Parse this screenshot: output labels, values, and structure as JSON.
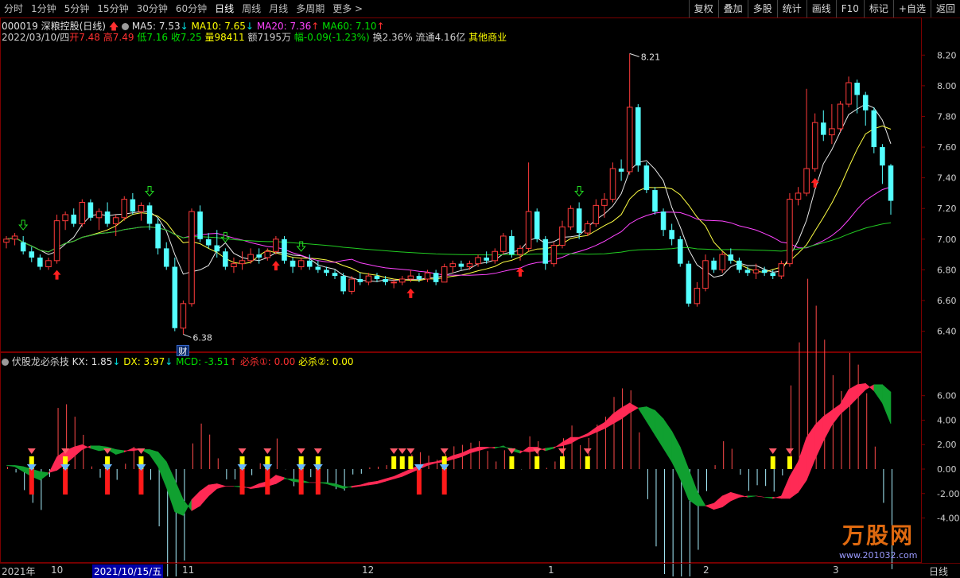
{
  "toolbar": {
    "tabs": [
      "分时",
      "1分钟",
      "5分钟",
      "15分钟",
      "30分钟",
      "60分钟",
      "日线",
      "周线",
      "月线",
      "多周期",
      "更多 >"
    ],
    "active_tab": "日线",
    "right_buttons": [
      "复权",
      "叠加",
      "多股",
      "统计",
      "画线",
      "F10",
      "标记",
      "+自选",
      "返回"
    ]
  },
  "stock": {
    "title": "000019 深粮控股(日线)",
    "ma5": "MA5: 7.53",
    "ma10": "MA10: 7.65",
    "ma20": "MA20: 7.36",
    "ma60": "MA60: 7.10",
    "date": "2022/03/10/四",
    "open": "开7.48",
    "high": "高7.49",
    "low": "低7.16",
    "close": "收7.25",
    "volume": "量98411",
    "amount": "额7195万",
    "change": "幅-0.09(-1.23%)",
    "turnover": "换2.36%",
    "float": "流通4.16亿",
    "sector": "其他商业"
  },
  "price_axis": [
    "8.20",
    "8.00",
    "7.80",
    "7.60",
    "7.40",
    "7.20",
    "7.00",
    "6.80",
    "6.60",
    "6.40"
  ],
  "annotations": {
    "high_label": "8.21",
    "low_label": "6.38",
    "fin_badge": "财"
  },
  "indicator": {
    "name": "伏股龙必杀技",
    "kx": "KX: 1.85",
    "dx": "DX: 3.97",
    "mcd": "MCD: -3.51",
    "bisha1": "必杀①: 0.00",
    "bisha2": "必杀②: 0.00",
    "axis": [
      "6.00",
      "4.00",
      "2.00",
      "0.00",
      "-2.00",
      "-4.00"
    ]
  },
  "dates": {
    "labels": [
      "2021年",
      "10",
      "2021/10/15/五",
      "11",
      "12",
      "1",
      "2",
      "3"
    ],
    "period": "日线"
  },
  "watermark": {
    "brand": "万股网",
    "url": "www.201032.com"
  },
  "chart_data": {
    "type": "candlestick",
    "title": "000019 深粮控股(日线)",
    "y_range": [
      6.32,
      8.3
    ],
    "marked_high": 8.21,
    "marked_low": 6.38,
    "candles": [
      [
        6.98,
        7.02,
        6.94,
        7.0
      ],
      [
        7.0,
        7.04,
        6.96,
        7.02
      ],
      [
        6.98,
        7.02,
        6.9,
        6.92
      ],
      [
        6.92,
        6.95,
        6.85,
        6.88
      ],
      [
        6.88,
        6.9,
        6.8,
        6.82
      ],
      [
        6.82,
        6.88,
        6.8,
        6.86
      ],
      [
        6.86,
        7.16,
        6.84,
        7.12
      ],
      [
        7.12,
        7.18,
        7.06,
        7.16
      ],
      [
        7.16,
        7.2,
        7.08,
        7.1
      ],
      [
        7.1,
        7.26,
        7.08,
        7.24
      ],
      [
        7.24,
        7.26,
        7.12,
        7.14
      ],
      [
        7.14,
        7.2,
        7.06,
        7.18
      ],
      [
        7.18,
        7.24,
        7.08,
        7.1
      ],
      [
        7.1,
        7.16,
        7.02,
        7.14
      ],
      [
        7.14,
        7.28,
        7.12,
        7.26
      ],
      [
        7.26,
        7.3,
        7.16,
        7.18
      ],
      [
        7.18,
        7.24,
        7.12,
        7.22
      ],
      [
        7.22,
        7.24,
        7.06,
        7.1
      ],
      [
        7.1,
        7.14,
        6.9,
        6.94
      ],
      [
        6.94,
        6.98,
        6.8,
        6.82
      ],
      [
        6.82,
        6.88,
        6.4,
        6.42
      ],
      [
        6.42,
        6.6,
        6.38,
        6.58
      ],
      [
        6.58,
        7.2,
        6.56,
        7.18
      ],
      [
        7.18,
        7.22,
        6.98,
        7.0
      ],
      [
        7.0,
        7.04,
        6.94,
        6.96
      ],
      [
        6.96,
        7.06,
        6.88,
        6.92
      ],
      [
        6.92,
        6.94,
        6.8,
        6.82
      ],
      [
        6.82,
        6.88,
        6.78,
        6.84
      ],
      [
        6.84,
        6.92,
        6.8,
        6.86
      ],
      [
        6.86,
        6.94,
        6.84,
        6.9
      ],
      [
        6.9,
        6.94,
        6.84,
        6.88
      ],
      [
        6.88,
        6.94,
        6.86,
        6.92
      ],
      [
        6.92,
        7.02,
        6.9,
        7.0
      ],
      [
        7.0,
        7.02,
        6.84,
        6.86
      ],
      [
        6.86,
        6.88,
        6.78,
        6.82
      ],
      [
        6.82,
        6.88,
        6.8,
        6.86
      ],
      [
        6.86,
        6.9,
        6.8,
        6.82
      ],
      [
        6.82,
        6.86,
        6.78,
        6.8
      ],
      [
        6.8,
        6.82,
        6.76,
        6.78
      ],
      [
        6.78,
        6.8,
        6.74,
        6.76
      ],
      [
        6.76,
        6.78,
        6.64,
        6.66
      ],
      [
        6.66,
        6.76,
        6.64,
        6.74
      ],
      [
        6.74,
        6.78,
        6.7,
        6.72
      ],
      [
        6.72,
        6.78,
        6.7,
        6.76
      ],
      [
        6.76,
        6.78,
        6.72,
        6.74
      ],
      [
        6.74,
        6.76,
        6.7,
        6.72
      ],
      [
        6.72,
        6.74,
        6.68,
        6.72
      ],
      [
        6.72,
        6.76,
        6.7,
        6.74
      ],
      [
        6.74,
        6.8,
        6.72,
        6.76
      ],
      [
        6.76,
        6.78,
        6.72,
        6.74
      ],
      [
        6.74,
        6.8,
        6.72,
        6.78
      ],
      [
        6.78,
        6.8,
        6.7,
        6.72
      ],
      [
        6.72,
        6.84,
        6.72,
        6.82
      ],
      [
        6.82,
        6.86,
        6.78,
        6.84
      ],
      [
        6.84,
        6.86,
        6.8,
        6.82
      ],
      [
        6.82,
        6.86,
        6.8,
        6.84
      ],
      [
        6.84,
        6.9,
        6.82,
        6.88
      ],
      [
        6.88,
        6.92,
        6.84,
        6.86
      ],
      [
        6.86,
        6.94,
        6.84,
        6.92
      ],
      [
        6.92,
        7.04,
        6.9,
        7.02
      ],
      [
        7.02,
        7.06,
        6.88,
        6.9
      ],
      [
        6.9,
        6.96,
        6.86,
        6.94
      ],
      [
        6.94,
        7.5,
        6.92,
        7.18
      ],
      [
        7.18,
        7.2,
        6.98,
        7.0
      ],
      [
        7.0,
        7.02,
        6.8,
        6.84
      ],
      [
        6.84,
        6.98,
        6.82,
        6.96
      ],
      [
        6.96,
        7.12,
        6.94,
        7.08
      ],
      [
        7.08,
        7.22,
        7.06,
        7.2
      ],
      [
        7.2,
        7.24,
        7.0,
        7.04
      ],
      [
        7.04,
        7.12,
        7.02,
        7.1
      ],
      [
        7.1,
        7.26,
        7.08,
        7.22
      ],
      [
        7.22,
        7.3,
        7.14,
        7.26
      ],
      [
        7.26,
        7.5,
        7.24,
        7.46
      ],
      [
        7.46,
        7.52,
        7.38,
        7.44
      ],
      [
        7.44,
        8.21,
        7.42,
        7.86
      ],
      [
        7.86,
        7.88,
        7.44,
        7.48
      ],
      [
        7.48,
        7.5,
        7.3,
        7.32
      ],
      [
        7.32,
        7.34,
        7.16,
        7.18
      ],
      [
        7.18,
        7.2,
        7.02,
        7.06
      ],
      [
        7.06,
        7.1,
        6.96,
        7.0
      ],
      [
        7.0,
        7.02,
        6.82,
        6.84
      ],
      [
        6.84,
        6.86,
        6.56,
        6.58
      ],
      [
        6.58,
        6.72,
        6.56,
        6.68
      ],
      [
        6.68,
        6.9,
        6.66,
        6.86
      ],
      [
        6.86,
        6.88,
        6.78,
        6.8
      ],
      [
        6.8,
        6.92,
        6.78,
        6.9
      ],
      [
        6.9,
        6.94,
        6.84,
        6.86
      ],
      [
        6.86,
        6.88,
        6.78,
        6.8
      ],
      [
        6.8,
        6.82,
        6.76,
        6.78
      ],
      [
        6.78,
        6.84,
        6.74,
        6.8
      ],
      [
        6.8,
        6.82,
        6.76,
        6.78
      ],
      [
        6.78,
        6.8,
        6.74,
        6.76
      ],
      [
        6.76,
        6.86,
        6.74,
        6.84
      ],
      [
        6.84,
        7.3,
        6.82,
        7.26
      ],
      [
        7.26,
        7.34,
        7.22,
        7.3
      ],
      [
        7.3,
        7.98,
        7.28,
        7.46
      ],
      [
        7.46,
        7.82,
        7.44,
        7.76
      ],
      [
        7.76,
        7.84,
        7.64,
        7.68
      ],
      [
        7.68,
        7.88,
        7.62,
        7.72
      ],
      [
        7.72,
        7.9,
        7.7,
        7.88
      ],
      [
        7.88,
        8.06,
        7.86,
        8.02
      ],
      [
        8.02,
        8.04,
        7.82,
        7.94
      ],
      [
        7.94,
        7.96,
        7.74,
        7.84
      ],
      [
        7.84,
        7.86,
        7.56,
        7.6
      ],
      [
        7.6,
        7.62,
        7.36,
        7.48
      ],
      [
        7.48,
        7.49,
        7.16,
        7.25
      ]
    ],
    "ma_series": [
      {
        "name": "MA5",
        "color": "#e8e8e8"
      },
      {
        "name": "MA10",
        "color": "#ffff44"
      },
      {
        "name": "MA20",
        "color": "#ff44ff"
      },
      {
        "name": "MA60",
        "color": "#22cc22"
      }
    ],
    "indicator_series": {
      "name": "伏股龙必杀技",
      "y_range": [
        -6.5,
        7.8
      ],
      "kx": [
        0.3,
        0.2,
        -0.2,
        -0.6,
        -0.9,
        -0.4,
        1.0,
        1.5,
        1.8,
        2.0,
        1.7,
        1.5,
        1.6,
        1.2,
        1.4,
        1.7,
        1.6,
        1.2,
        0.2,
        -1.5,
        -3.5,
        -3.8,
        -2.5,
        -1.8,
        -1.3,
        -1.2,
        -1.4,
        -1.4,
        -1.5,
        -1.5,
        -1.2,
        -1.0,
        -0.5,
        -0.7,
        -1.0,
        -1.1,
        -1.1,
        -1.1,
        -1.2,
        -1.4,
        -1.6,
        -1.4,
        -1.3,
        -1.1,
        -1.0,
        -0.8,
        -0.6,
        -0.3,
        0.0,
        0.3,
        0.5,
        0.6,
        0.8,
        1.1,
        1.3,
        1.6,
        1.8,
        1.8,
        1.7,
        1.9,
        1.5,
        1.3,
        1.8,
        1.8,
        1.5,
        1.7,
        2.2,
        2.6,
        2.6,
        2.9,
        3.4,
        3.8,
        4.5,
        5.0,
        5.4,
        5.0,
        3.9,
        2.8,
        1.7,
        0.6,
        -0.8,
        -2.5,
        -3.0,
        -3.0,
        -2.8,
        -2.2,
        -1.9,
        -2.1,
        -2.3,
        -2.2,
        -2.3,
        -2.4,
        -2.2,
        -0.6,
        0.6,
        2.6,
        3.6,
        4.3,
        4.8,
        5.3,
        6.5,
        6.9,
        7.0,
        6.4,
        5.4,
        3.7
      ],
      "dx": [
        0.3,
        0.3,
        0.2,
        0.0,
        -0.2,
        -0.3,
        -0.1,
        0.4,
        1.0,
        1.6,
        1.9,
        1.9,
        1.8,
        1.6,
        1.5,
        1.5,
        1.6,
        1.6,
        1.4,
        0.6,
        -0.9,
        -2.5,
        -3.4,
        -3.0,
        -2.2,
        -1.6,
        -1.4,
        -1.4,
        -1.4,
        -1.6,
        -1.5,
        -1.4,
        -1.2,
        -0.8,
        -0.8,
        -0.9,
        -1.1,
        -1.1,
        -1.1,
        -1.2,
        -1.4,
        -1.5,
        -1.4,
        -1.3,
        -1.2,
        -1.0,
        -0.8,
        -0.6,
        -0.3,
        0.0,
        0.3,
        0.5,
        0.6,
        0.8,
        1.0,
        1.3,
        1.5,
        1.7,
        1.8,
        1.8,
        1.7,
        1.5,
        1.4,
        1.5,
        1.7,
        1.8,
        1.9,
        2.1,
        2.5,
        2.7,
        3.0,
        3.3,
        3.7,
        4.1,
        4.6,
        5.0,
        5.1,
        4.8,
        4.1,
        3.1,
        1.8,
        0.0,
        -1.8,
        -3.0,
        -3.3,
        -3.1,
        -2.6,
        -2.3,
        -2.2,
        -2.2,
        -2.3,
        -2.3,
        -2.4,
        -2.4,
        -1.9,
        -0.9,
        0.8,
        2.3,
        3.6,
        4.5,
        5.1,
        5.8,
        6.5,
        6.9,
        6.9,
        6.3
      ],
      "bisha1_days": [
        3,
        7,
        12,
        16,
        28,
        31,
        35,
        37,
        49,
        52
      ],
      "bisha2_days": [
        3,
        7,
        12,
        16,
        28,
        31,
        35,
        37,
        46,
        47,
        48,
        52,
        60,
        63,
        66,
        69,
        91,
        93
      ]
    }
  }
}
